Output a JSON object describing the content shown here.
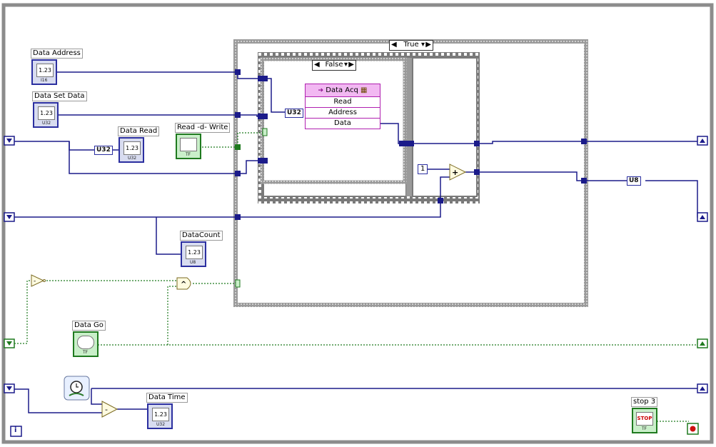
{
  "case_structure": {
    "selector_label": "True"
  },
  "inner_case": {
    "selector_label": "False"
  },
  "controls": {
    "data_address": {
      "label": "Data Address",
      "display": "1.23",
      "type_code": "I16"
    },
    "data_set_data": {
      "label": "Data Set Data",
      "display": "1.23",
      "type_code": "U32"
    },
    "data_read": {
      "label": "Data Read",
      "display": "1.23",
      "type_code": "U32"
    },
    "read_write": {
      "label": "Read -d- Write",
      "type_code": "TF"
    },
    "data_count": {
      "label": "DataCount",
      "display": "1.23",
      "type_code": "U8"
    },
    "data_go": {
      "label": "Data Go",
      "type_code": "TF"
    },
    "data_time": {
      "label": "Data Time",
      "display": "1.23",
      "type_code": "U32"
    },
    "stop": {
      "label": "stop 3",
      "button_text": "STOP",
      "type_code": "TF"
    }
  },
  "conversions": {
    "u32_a": "U32",
    "u32_b": "U32",
    "u8": "U8"
  },
  "data_acq_node": {
    "title": "Data Acq",
    "rows": [
      "Read",
      "Address",
      "Data"
    ]
  },
  "constants": {
    "one": "1"
  },
  "functions": {
    "add": "+",
    "and": "^",
    "subtract": "-",
    "not": "-"
  },
  "loop_iteration": "i",
  "colors": {
    "numeric_wire": "#1b1b8a",
    "boolean_wire": "#1f7a1f",
    "case_frame": "#7a7a7a",
    "loop_frame": "#8c8c8c",
    "node_accent": "#b020b0"
  }
}
